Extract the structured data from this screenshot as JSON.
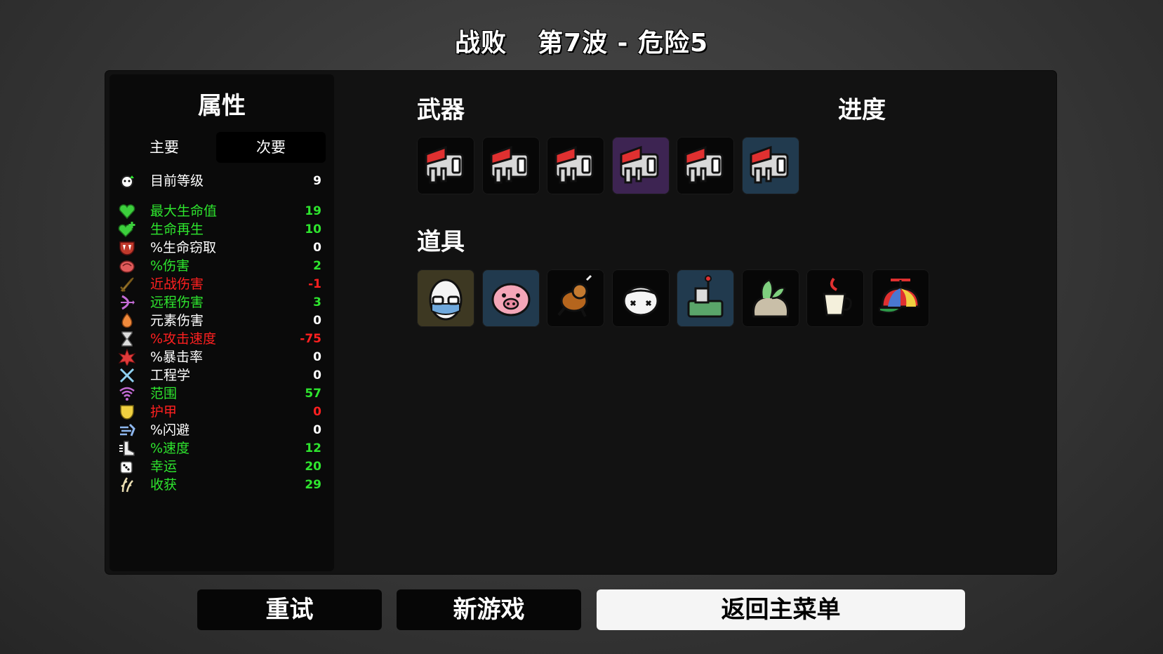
{
  "header": {
    "result": "战败",
    "wave": "第7波 - 危险5"
  },
  "stats_panel": {
    "title": "属性",
    "tabs": {
      "main": "主要",
      "secondary": "次要"
    },
    "rows": [
      {
        "icon": "level-icon",
        "name": "目前等级",
        "value": "9",
        "color": "#ffffff"
      },
      {
        "icon": "heart-icon",
        "name": "最大生命值",
        "value": "19",
        "color": "#2ee52e"
      },
      {
        "icon": "heart-plus-icon",
        "name": "生命再生",
        "value": "10",
        "color": "#2ee52e"
      },
      {
        "icon": "fang-icon",
        "name": "%生命窃取",
        "value": "0",
        "color": "#ffffff"
      },
      {
        "icon": "muscle-icon",
        "name": "%伤害",
        "value": "2",
        "color": "#2ee52e"
      },
      {
        "icon": "sword-icon",
        "name": "近战伤害",
        "value": "-1",
        "color": "#ff2020"
      },
      {
        "icon": "bow-icon",
        "name": "远程伤害",
        "value": "3",
        "color": "#2ee52e"
      },
      {
        "icon": "flame-icon",
        "name": "元素伤害",
        "value": "0",
        "color": "#ffffff"
      },
      {
        "icon": "hourglass-icon",
        "name": "%攻击速度",
        "value": "-75",
        "color": "#ff2020"
      },
      {
        "icon": "crit-icon",
        "name": "%暴击率",
        "value": "0",
        "color": "#ffffff"
      },
      {
        "icon": "wrench-icon",
        "name": "工程学",
        "value": "0",
        "color": "#ffffff"
      },
      {
        "icon": "range-icon",
        "name": "范围",
        "value": "57",
        "color": "#2ee52e"
      },
      {
        "icon": "shield-icon",
        "name": "护甲",
        "value": "0",
        "color": "#ff2020"
      },
      {
        "icon": "dodge-icon",
        "name": "%闪避",
        "value": "0",
        "color": "#ffffff"
      },
      {
        "icon": "boot-icon",
        "name": "%速度",
        "value": "12",
        "color": "#2ee52e"
      },
      {
        "icon": "dice-icon",
        "name": "幸运",
        "value": "20",
        "color": "#2ee52e"
      },
      {
        "icon": "harvest-icon",
        "name": "收获",
        "value": "29",
        "color": "#2ee52e"
      }
    ]
  },
  "weapons": {
    "title": "武器",
    "items": [
      {
        "icon": "megaphone-weapon-icon",
        "tier_color": "#070707"
      },
      {
        "icon": "megaphone-weapon-icon",
        "tier_color": "#070707"
      },
      {
        "icon": "megaphone-weapon-icon",
        "tier_color": "#070707"
      },
      {
        "icon": "megaphone-weapon-icon",
        "tier_color": "#3d2452"
      },
      {
        "icon": "megaphone-weapon-icon",
        "tier_color": "#070707"
      },
      {
        "icon": "megaphone-weapon-icon",
        "tier_color": "#213a4e"
      }
    ]
  },
  "progress": {
    "title": "进度"
  },
  "items": {
    "title": "道具",
    "items": [
      {
        "icon": "egg-glasses-icon",
        "tier_color": "#3d3822"
      },
      {
        "icon": "piggy-bank-icon",
        "tier_color": "#213a4e"
      },
      {
        "icon": "running-dog-icon",
        "tier_color": "#070707"
      },
      {
        "icon": "bandaged-head-icon",
        "tier_color": "#070707"
      },
      {
        "icon": "turret-machine-icon",
        "tier_color": "#213a4e"
      },
      {
        "icon": "plant-sack-icon",
        "tier_color": "#070707"
      },
      {
        "icon": "coffee-cup-icon",
        "tier_color": "#070707"
      },
      {
        "icon": "propeller-cap-icon",
        "tier_color": "#070707"
      }
    ]
  },
  "buttons": {
    "retry": "重试",
    "new_game": "新游戏",
    "main_menu": "返回主菜单"
  }
}
